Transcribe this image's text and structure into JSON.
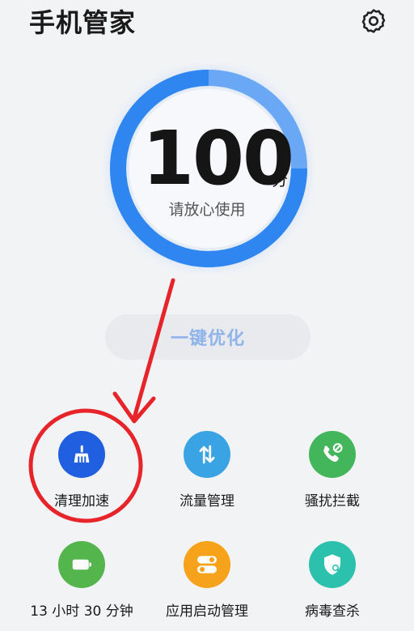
{
  "header": {
    "title": "手机管家"
  },
  "score": {
    "value": "100",
    "unit": "分",
    "status": "请放心使用",
    "ring_fill": 1.0
  },
  "optimize": {
    "label": "一键优化"
  },
  "tools": [
    {
      "label": "清理加速",
      "icon": "broom-icon",
      "color": "#1f5fe0"
    },
    {
      "label": "流量管理",
      "icon": "data-arrows-icon",
      "color": "#3aa3e4"
    },
    {
      "label": "骚扰拦截",
      "icon": "phone-block-icon",
      "color": "#43b55a"
    },
    {
      "label": "13 小时 30 分钟",
      "icon": "battery-icon",
      "color": "#53b54c"
    },
    {
      "label": "应用启动管理",
      "icon": "toggle-icon",
      "color": "#f6a21a"
    },
    {
      "label": "病毒查杀",
      "icon": "shield-scan-icon",
      "color": "#2cc1ad"
    }
  ],
  "colors": {
    "ring_blue": "#2f86f0",
    "annotation_red": "#e6242a",
    "background": "#f1f3f5"
  }
}
